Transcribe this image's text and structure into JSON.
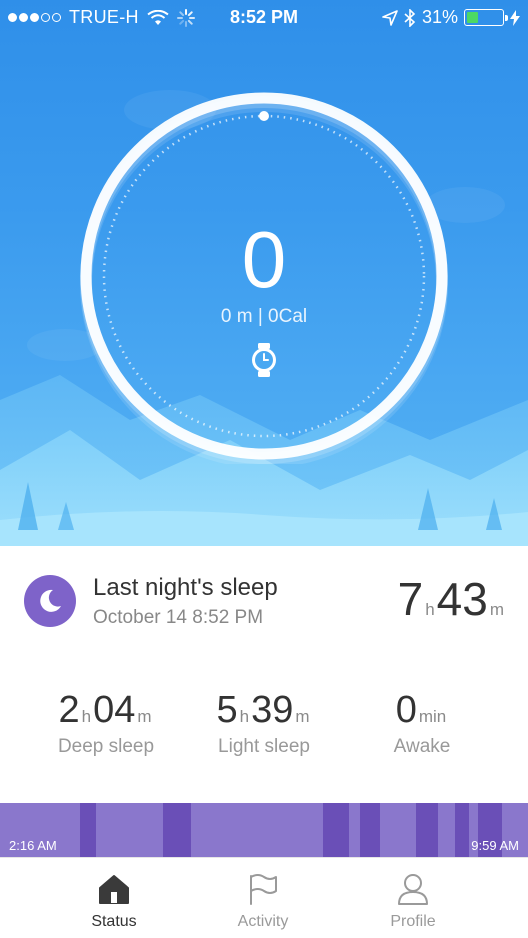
{
  "status_bar": {
    "carrier": "TRUE-H",
    "time": "8:52 PM",
    "battery": "31%",
    "battery_level": 0.31
  },
  "steps": {
    "count": "0",
    "summary": "0 m | 0Cal",
    "device_icon": "watch-icon"
  },
  "sleep": {
    "title": "Last night's sleep",
    "date": "October 14 8:52 PM",
    "total": {
      "hours": "7",
      "hours_unit": "h",
      "minutes": "43",
      "minutes_unit": "m"
    },
    "metrics": [
      {
        "label": "Deep sleep",
        "hours": "2",
        "hours_unit": "h",
        "minutes": "04",
        "minutes_unit": "m"
      },
      {
        "label": "Light sleep",
        "hours": "5",
        "hours_unit": "h",
        "minutes": "39",
        "minutes_unit": "m"
      },
      {
        "label": "Awake",
        "minutes": "0",
        "minutes_unit": "min"
      }
    ],
    "timeline": {
      "start": "2:16 AM",
      "end": "9:59 AM"
    },
    "colors": {
      "light": "#8a77cc",
      "deep": "#6a4fb7",
      "accent": "#7e63c9"
    }
  },
  "tabs": [
    {
      "label": "Status",
      "icon": "home-icon",
      "active": true
    },
    {
      "label": "Activity",
      "icon": "flag-icon",
      "active": false
    },
    {
      "label": "Profile",
      "icon": "person-icon",
      "active": false
    }
  ]
}
